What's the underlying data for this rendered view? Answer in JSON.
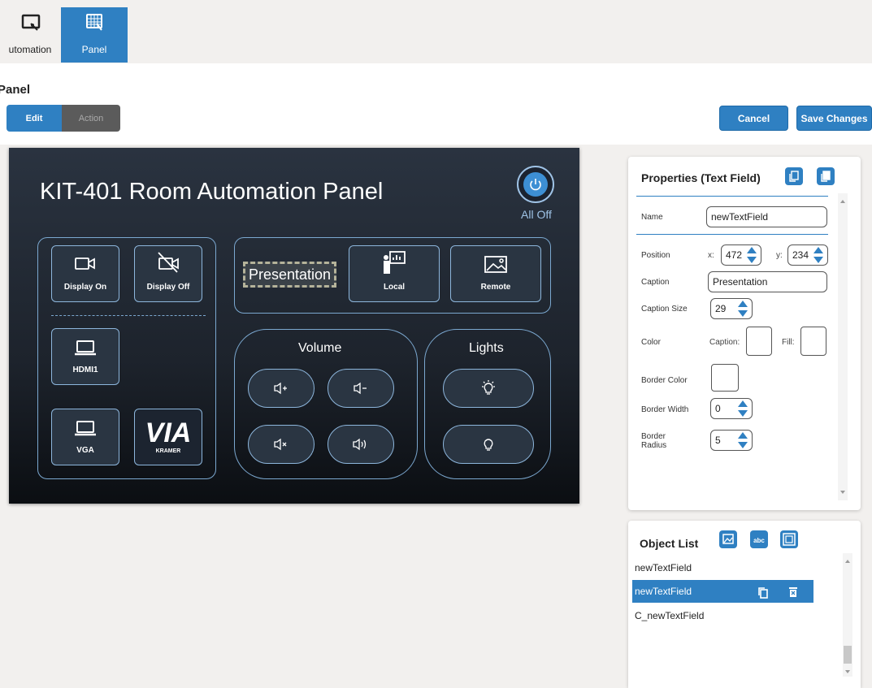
{
  "nav": {
    "tabs": [
      {
        "label": "utomation",
        "icon": "touch-screen-icon"
      },
      {
        "label": "Panel",
        "icon": "panel-grid-icon",
        "active": true
      }
    ]
  },
  "page": {
    "title": "Panel"
  },
  "mode": {
    "edit": "Edit",
    "action": "Action"
  },
  "toolbar": {
    "cancel": "Cancel",
    "save": "Save Changes"
  },
  "canvas": {
    "title": "KIT-401 Room Automation Panel",
    "all_off": "All Off",
    "display_on": "Display On",
    "display_off": "Display Off",
    "hdmi1": "HDMI1",
    "vga": "VGA",
    "kramer_logo": "VIA KRAMER",
    "presentation": "Presentation",
    "local": "Local",
    "remote": "Remote",
    "volume": "Volume",
    "lights": "Lights"
  },
  "properties": {
    "title": "Properties (Text Field)",
    "name_label": "Name",
    "name_value": "newTextField",
    "position_label": "Position",
    "x_label": "x:",
    "x_value": "472",
    "y_label": "y:",
    "y_value": "234",
    "caption_label": "Caption",
    "caption_value": "Presentation",
    "caption_size_label": "Caption Size",
    "caption_size_value": "29",
    "color_label": "Color",
    "caption_color_label": "Caption:",
    "fill_label": "Fill:",
    "border_color_label": "Border Color",
    "border_width_label": "Border Width",
    "border_width_value": "0",
    "border_radius_label_1": "Border",
    "border_radius_label_2": "Radius",
    "border_radius_value": "5"
  },
  "object_list": {
    "title": "Object List",
    "items": [
      "newTextField",
      "newTextField",
      "C_newTextField"
    ],
    "selected_index": 1
  },
  "colors": {
    "accent": "#2f80c2",
    "canvas_top": "#2a3340",
    "canvas_bottom": "#0b0e12"
  }
}
